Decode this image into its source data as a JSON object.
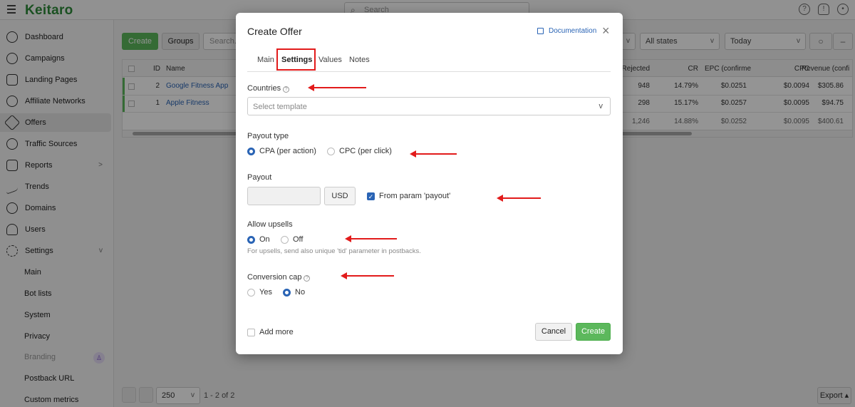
{
  "app": {
    "logo": "Keitaro",
    "search_placeholder": "Search"
  },
  "sidebar": {
    "items": [
      {
        "label": "Dashboard"
      },
      {
        "label": "Campaigns"
      },
      {
        "label": "Landing Pages"
      },
      {
        "label": "Affiliate Networks"
      },
      {
        "label": "Offers"
      },
      {
        "label": "Traffic Sources"
      },
      {
        "label": "Reports"
      },
      {
        "label": "Trends"
      },
      {
        "label": "Domains"
      },
      {
        "label": "Users"
      },
      {
        "label": "Settings"
      }
    ],
    "sub_items": [
      {
        "label": "Main"
      },
      {
        "label": "Bot lists"
      },
      {
        "label": "System"
      },
      {
        "label": "Privacy"
      },
      {
        "label": "Branding"
      },
      {
        "label": "Postback URL"
      },
      {
        "label": "Custom metrics"
      }
    ]
  },
  "toolbar": {
    "create": "Create",
    "groups": "Groups",
    "search_placeholder": "Search...",
    "state_filter": "All states",
    "date_filter": "Today"
  },
  "grid": {
    "headers": {
      "id": "ID",
      "name": "Name",
      "rejected": "Rejected",
      "cr": "CR",
      "epc": "EPC (confirme",
      "cpc": "CPC",
      "revenue": "Revenue (confi"
    },
    "rows": [
      {
        "id": "2",
        "name": "Google Fitness App",
        "rejected": "948",
        "cr": "14.79%",
        "epc": "$0.0251",
        "cpc": "$0.0094",
        "revenue": "$305.86"
      },
      {
        "id": "1",
        "name": "Apple Fitness",
        "rejected": "298",
        "cr": "15.17%",
        "epc": "$0.0257",
        "cpc": "$0.0095",
        "revenue": "$94.75"
      }
    ],
    "totals": {
      "rejected": "1,246",
      "cr": "14.88%",
      "epc": "$0.0252",
      "cpc": "$0.0095",
      "revenue": "$400.61"
    }
  },
  "pager": {
    "per_page": "250",
    "info": "1 - 2 of 2",
    "export": "Export"
  },
  "modal": {
    "title": "Create Offer",
    "documentation": "Documentation",
    "close": "×",
    "tabs": [
      "Main",
      "Settings",
      "Values",
      "Notes"
    ],
    "active_tab": "Settings",
    "countries": {
      "label": "Countries",
      "placeholder": "Select template"
    },
    "payout_type": {
      "label": "Payout type",
      "options": [
        "CPA (per action)",
        "CPC (per click)"
      ],
      "selected": "CPA (per action)"
    },
    "payout": {
      "label": "Payout",
      "value": "",
      "currency": "USD",
      "from_param_label": "From param 'payout'",
      "from_param_checked": true
    },
    "allow_upsells": {
      "label": "Allow upsells",
      "options": [
        "On",
        "Off"
      ],
      "selected": "On",
      "hint": "For upsells, send also unique 'tid' parameter in postbacks."
    },
    "conversion_cap": {
      "label": "Conversion cap",
      "options": [
        "Yes",
        "No"
      ],
      "selected": "No"
    },
    "add_more": {
      "label": "Add more",
      "checked": false
    },
    "cancel": "Cancel",
    "create": "Create"
  },
  "colors": {
    "brand": "#2e8b3a",
    "primary": "#5cb85c",
    "link": "#2a64b5",
    "annotation": "#e21b1b"
  }
}
